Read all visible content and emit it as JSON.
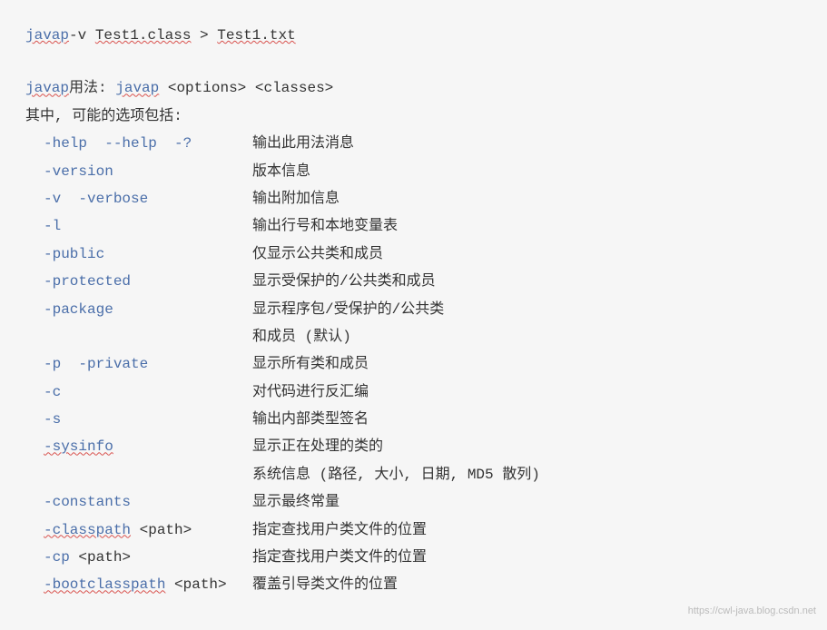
{
  "command": {
    "cmd": "javap",
    "args_part1": "-v ",
    "file1": "Test1.class",
    "args_part2": " > ",
    "file2": "Test1.txt"
  },
  "usage": {
    "prefix": "javap",
    "label": "用法: ",
    "cmd2": "javap",
    "options": " <options> <classes>"
  },
  "subtitle": "其中, 可能的选项包括:",
  "options": [
    {
      "flag": "-help  --help  -?",
      "desc": "输出此用法消息",
      "underline": false
    },
    {
      "flag": "-version",
      "desc": "版本信息",
      "underline": false
    },
    {
      "flag": "-v  -verbose",
      "desc": "输出附加信息",
      "underline": false
    },
    {
      "flag": "-l",
      "desc": "输出行号和本地变量表",
      "underline": false
    },
    {
      "flag": "-public",
      "desc": "仅显示公共类和成员",
      "underline": false
    },
    {
      "flag": "-protected",
      "desc": "显示受保护的/公共类和成员",
      "underline": false
    },
    {
      "flag": "-package",
      "desc": "显示程序包/受保护的/公共类",
      "underline": false
    },
    {
      "flag": "",
      "desc": "和成员 (默认)",
      "underline": false
    },
    {
      "flag": "-p  -private",
      "desc": "显示所有类和成员",
      "underline": false
    },
    {
      "flag": "-c",
      "desc": "对代码进行反汇编",
      "underline": false
    },
    {
      "flag": "-s",
      "desc": "输出内部类型签名",
      "underline": false
    },
    {
      "flag": "-sysinfo",
      "desc": "显示正在处理的类的",
      "underline": true
    },
    {
      "flag": "",
      "desc": "系统信息 (路径, 大小, 日期, MD5 散列)",
      "underline": false
    },
    {
      "flag": "-constants",
      "desc": "显示最终常量",
      "underline": false
    },
    {
      "flag": "-classpath",
      "tail": " <path>",
      "desc": "指定查找用户类文件的位置",
      "underline": true
    },
    {
      "flag": "-cp",
      "tail": " <path>",
      "desc": "指定查找用户类文件的位置",
      "underline": false
    },
    {
      "flag": "-bootclasspath",
      "tail": " <path>",
      "desc": "覆盖引导类文件的位置",
      "underline": true
    }
  ],
  "watermark": "https://cwl-java.blog.csdn.net"
}
